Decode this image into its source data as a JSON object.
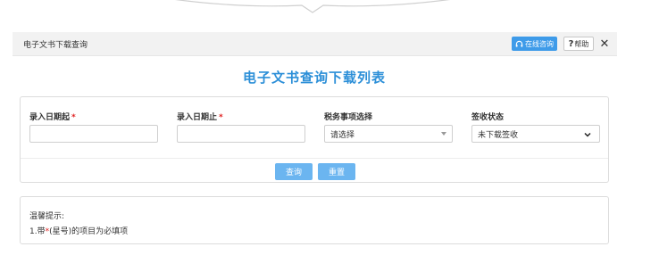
{
  "window": {
    "title": "电子文书下载查询",
    "consult_label": "在线咨询",
    "help_label": "帮助",
    "help_glyph": "?",
    "close_glyph": "✕"
  },
  "page": {
    "title": "电子文书查询下载列表"
  },
  "form": {
    "start_date": {
      "label": "录入日期起",
      "required_mark": "*",
      "value": ""
    },
    "end_date": {
      "label": "录入日期止",
      "required_mark": "*",
      "value": ""
    },
    "tax_matter": {
      "label": "税务事项选择",
      "selected": "请选择"
    },
    "sign_status": {
      "label": "签收状态",
      "selected": "未下载签收"
    },
    "query_button": "查询",
    "reset_button": "重置"
  },
  "tips": {
    "heading": "温馨提示:",
    "line_prefix": "1.带",
    "line_mark": "*",
    "line_suffix": "(星号)的项目为必填项"
  },
  "colors": {
    "title_blue": "#2c8fd8",
    "button_blue": "#6bb5f0",
    "consult_blue": "#3e9be9",
    "required_red": "#e02020"
  }
}
